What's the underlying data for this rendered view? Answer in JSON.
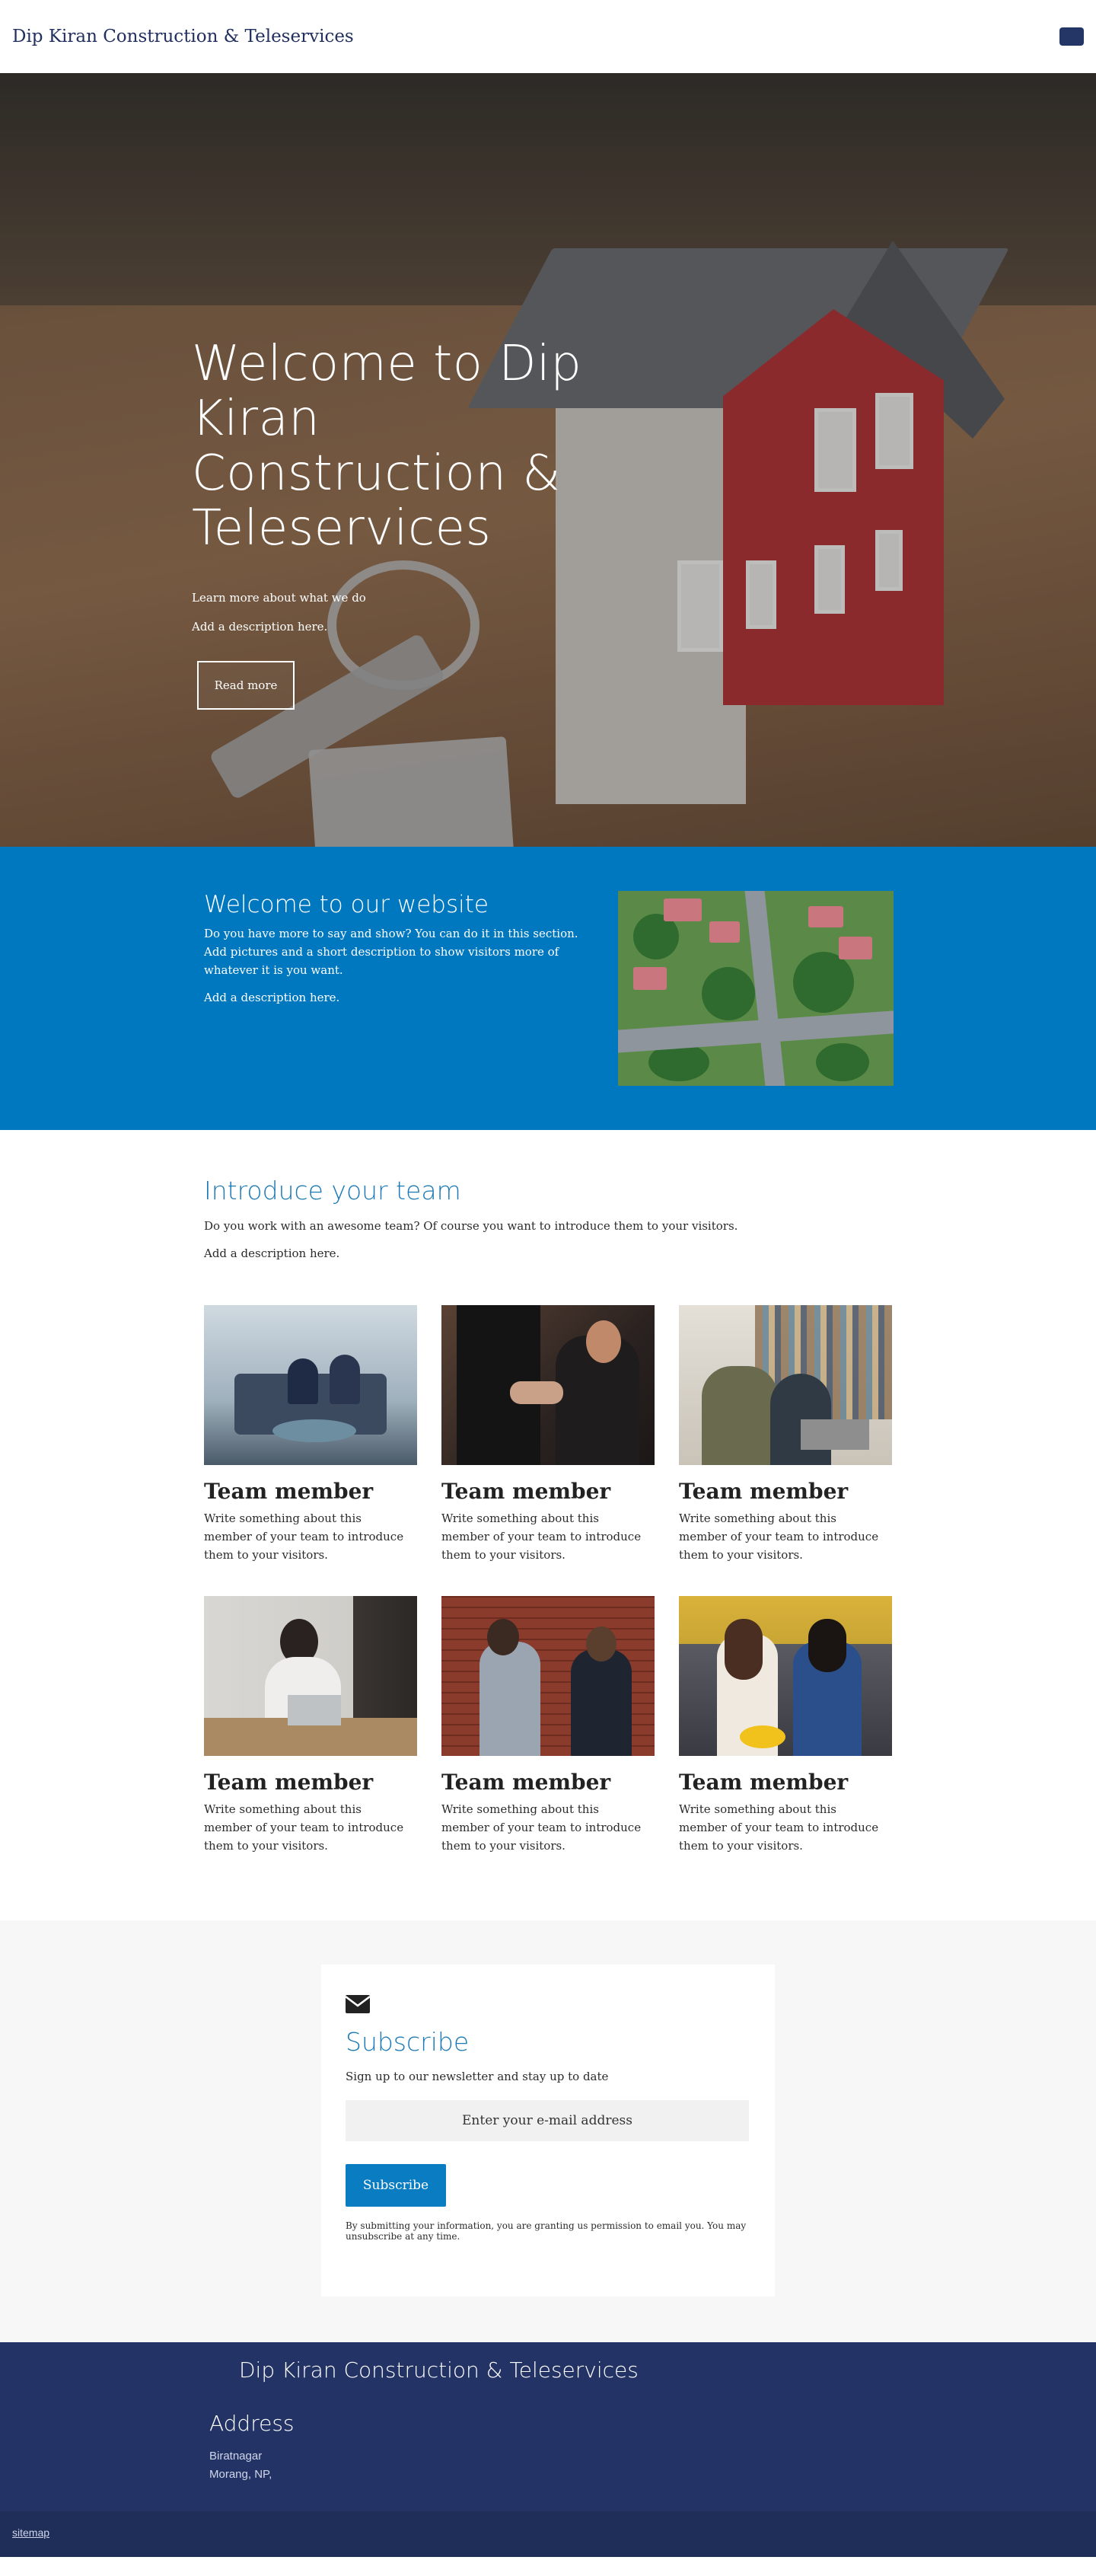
{
  "header": {
    "site_title": "Dip Kiran Construction & Teleservices",
    "menu_icon": "hamburger-menu-icon"
  },
  "hero": {
    "title": "Welcome to Dip Kiran Construction & Teleservices",
    "subtitle": "Learn more about what we do",
    "description": "Add a description here.",
    "button_label": "Read more"
  },
  "welcome": {
    "title": "Welcome to our website",
    "body": "Do you have more to say and show? You can do it in this section. Add pictures and a short description to show visitors more of whatever it is you want.",
    "description": "Add a description here."
  },
  "team": {
    "title": "Introduce your team",
    "intro": "Do you work with an awesome team? Of course you want to introduce them to your visitors.",
    "description": "Add a description here.",
    "members": [
      {
        "name": "Team member",
        "text": "Write something about this member of your team to introduce them to your visitors."
      },
      {
        "name": "Team member",
        "text": "Write something about this member of your team to introduce them to your visitors."
      },
      {
        "name": "Team member",
        "text": "Write something about this member of your team to introduce them to your visitors."
      },
      {
        "name": "Team member",
        "text": "Write something about this member of your team to introduce them to your visitors."
      },
      {
        "name": "Team member",
        "text": "Write something about this member of your team to introduce them to your visitors."
      },
      {
        "name": "Team member",
        "text": "Write something about this member of your team to introduce them to your visitors."
      }
    ]
  },
  "subscribe": {
    "icon": "envelope-icon",
    "title": "Subscribe",
    "subtitle": "Sign up to our newsletter and stay up to date",
    "email_placeholder": "Enter your e-mail address",
    "button_label": "Subscribe",
    "legal": "By submitting your information, you are granting us permission to email you. You may unsubscribe at any time."
  },
  "footer": {
    "title": "Dip Kiran Construction & Teleservices",
    "address_heading": "Address",
    "address_line1": "Biratnagar",
    "address_line2": "Morang, NP,",
    "sitemap_label": "sitemap"
  },
  "colors": {
    "brand_blue": "#0078bf",
    "navy": "#243366",
    "title_blue": "#1d7ab6"
  }
}
